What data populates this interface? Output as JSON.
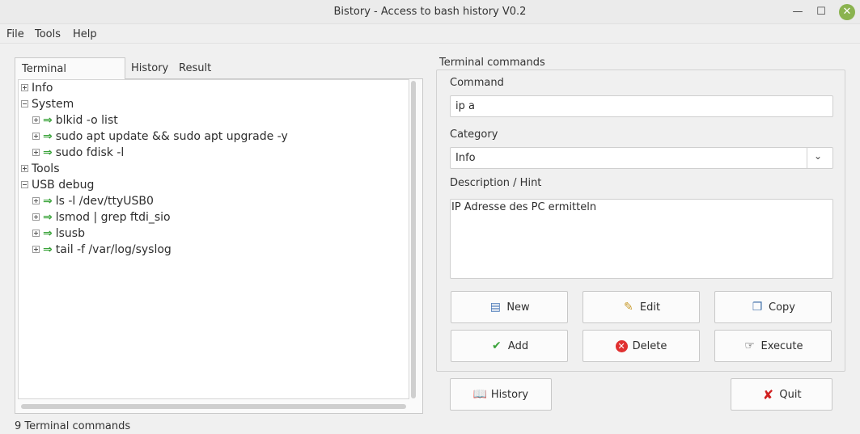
{
  "window": {
    "title": "Bistory - Access to bash history  V0.2",
    "minimize_glyph": "—",
    "maximize_glyph": "☐",
    "close_glyph": "✕"
  },
  "menu": [
    "File",
    "Tools",
    "Help"
  ],
  "tabs": [
    "Terminal commands",
    "History",
    "Result"
  ],
  "tree": {
    "categories": [
      {
        "label": "Info",
        "expanded": false,
        "items": []
      },
      {
        "label": "System",
        "expanded": true,
        "items": [
          "blkid -o list",
          "sudo apt update && sudo apt upgrade -y",
          "sudo fdisk -l"
        ]
      },
      {
        "label": "Tools",
        "expanded": false,
        "items": []
      },
      {
        "label": "USB debug",
        "expanded": true,
        "items": [
          "ls -l /dev/ttyUSB0",
          "lsmod | grep ftdi_sio",
          "lsusb",
          "tail -f /var/log/syslog"
        ]
      }
    ]
  },
  "status": "9 Terminal commands",
  "form": {
    "group_title": "Terminal commands",
    "command_label": "Command",
    "command_value": "ip a",
    "category_label": "Category",
    "category_value": "Info",
    "description_label": "Description / Hint",
    "description_value": "IP Adresse des PC ermitteln"
  },
  "buttons": {
    "new": "New",
    "edit": "Edit",
    "copy": "Copy",
    "add": "Add",
    "delete": "Delete",
    "execute": "Execute",
    "history": "History",
    "quit": "Quit"
  },
  "colors": {
    "arrow": "#3aa33a",
    "close_button": "#8ab34f",
    "delete_icon": "#e03030",
    "quit_icon": "#d02020"
  }
}
